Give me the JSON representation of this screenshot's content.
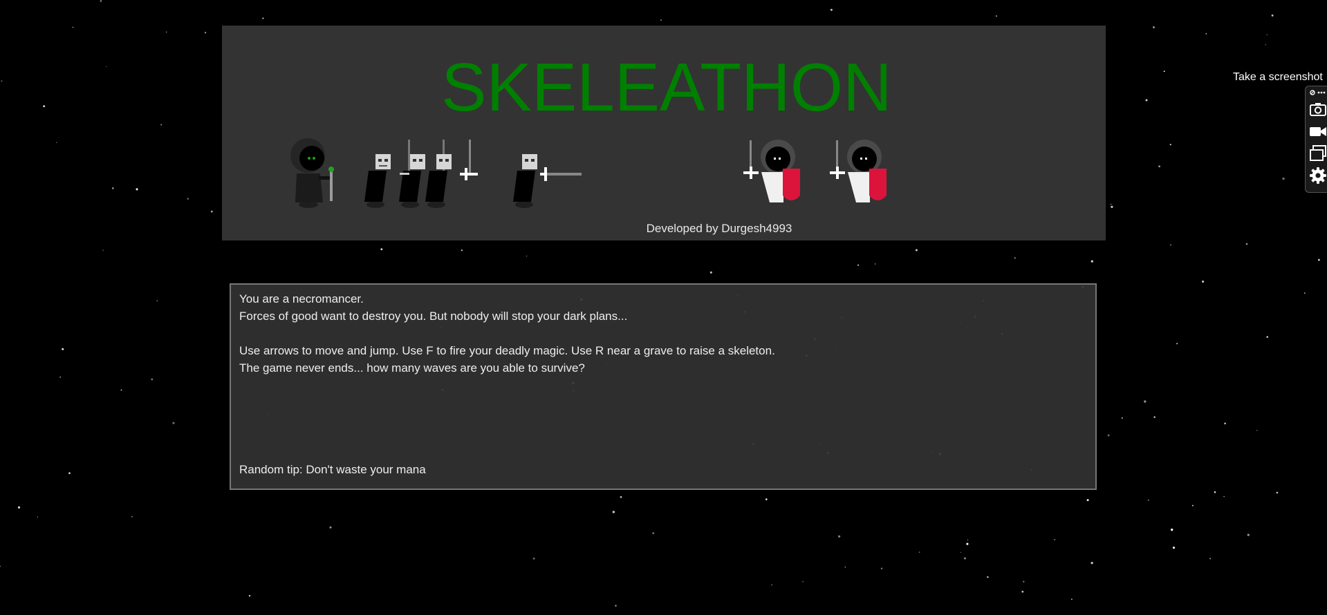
{
  "game": {
    "title": "SKELEATHON",
    "credit": "Developed by Durgesh4993",
    "title_color": "#008000",
    "banner_color": "#333333",
    "accent_red": "#dc143c"
  },
  "info": {
    "line1": "You are a necromancer.",
    "line2": "Forces of good want to destroy you. But nobody will stop your dark plans...",
    "line3": "Use arrows to move and jump. Use F to fire your deadly magic. Use R near a grave to raise a skeleton.",
    "line4": "The game never ends... how many waves are you able to survive?",
    "tip": "Random tip: Don't waste your mana"
  },
  "screenshot_tool": {
    "label": "Take a screenshot",
    "buttons": [
      {
        "icon": "camera-icon"
      },
      {
        "icon": "video-camera-icon"
      },
      {
        "icon": "copy-windows-icon"
      },
      {
        "icon": "gear-icon"
      }
    ]
  }
}
